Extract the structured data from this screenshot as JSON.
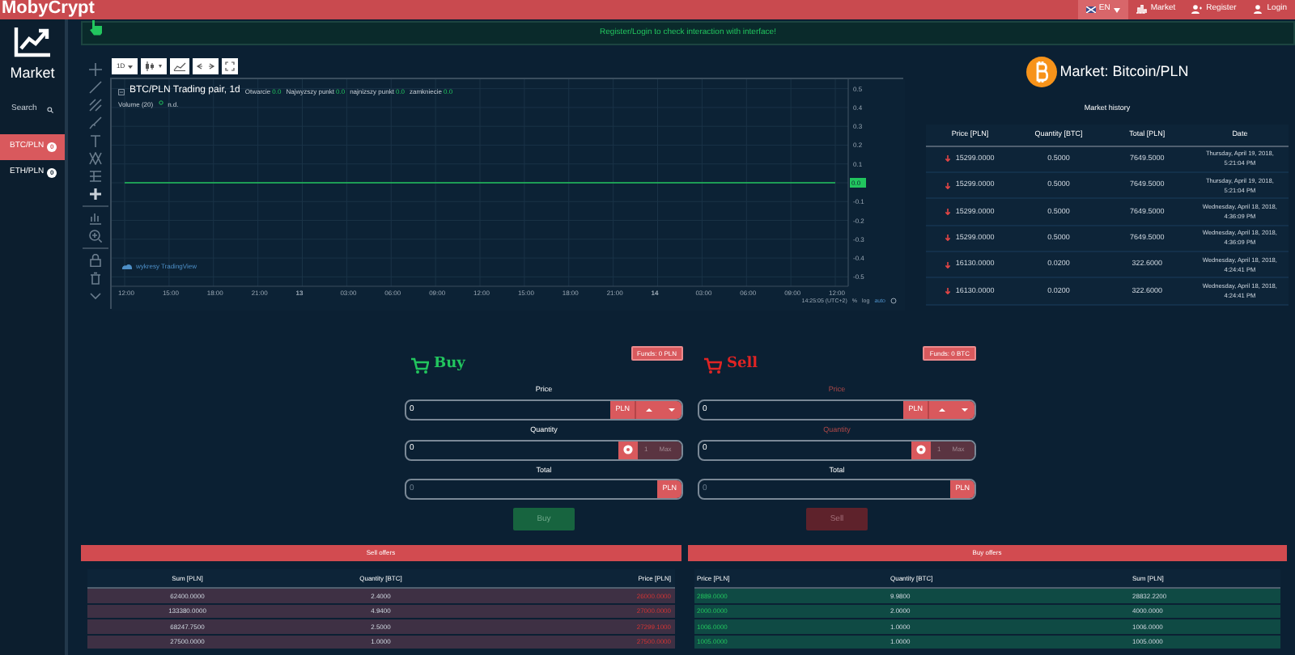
{
  "header": {
    "logo": "MobyCrypt",
    "language": {
      "label": "EN"
    },
    "nav": [
      {
        "label": "Market",
        "kind": "market"
      },
      {
        "label": "Register",
        "kind": "register"
      },
      {
        "label": "Login",
        "kind": "login"
      }
    ]
  },
  "sidebar": {
    "title": "Market",
    "search": {
      "placeholder": "Search"
    },
    "pairs": [
      {
        "label": "BTC/PLN",
        "count": "0",
        "selected": true
      },
      {
        "label": "ETH/PLN",
        "count": "0",
        "selected": false
      }
    ]
  },
  "banner": "Register/Login to check interaction with interface!",
  "chart_toolbar": {
    "interval": "1D"
  },
  "chart": {
    "title": "BTC/PLN Trading pair, 1d",
    "legend": [
      {
        "label": "Otwarcie",
        "value": "0.0"
      },
      {
        "label": "Najwyzszy punkt",
        "value": "0.0"
      },
      {
        "label": "najnizszy punkt",
        "value": "0.0"
      },
      {
        "label": "zamkniecie",
        "value": "0.0"
      }
    ],
    "volume": {
      "label": "Volume (20)",
      "value": "n.d."
    },
    "attribution": "wykresy TradingView",
    "time": "14:25:05 (UTC+2)",
    "options": [
      "%",
      "log",
      "auto"
    ],
    "chart_data": {
      "type": "line",
      "x": [
        "12:00",
        "15:00",
        "18:00",
        "21:00",
        "13",
        "03:00",
        "06:00",
        "09:00",
        "12:00",
        "15:00",
        "18:00",
        "21:00",
        "14",
        "03:00",
        "06:00",
        "09:00",
        "12:00"
      ],
      "series": [
        {
          "color": "#22c55e",
          "values": [
            0,
            0,
            0,
            0,
            0,
            0,
            0,
            0,
            0,
            0,
            0,
            0,
            0,
            0,
            0,
            0,
            0
          ]
        }
      ],
      "grid": true,
      "ylim": [
        -0.55,
        0.55
      ],
      "yticks": [
        {
          "value": 0.5,
          "label": "0.5"
        },
        {
          "value": 0.4,
          "label": "0.4"
        },
        {
          "value": 0.3,
          "label": "0.3"
        },
        {
          "value": 0.2,
          "label": "0.2"
        },
        {
          "value": 0.1,
          "label": "0.1"
        },
        {
          "value": 0,
          "label": "0.0"
        },
        {
          "value": -0.1,
          "label": "-0.1"
        },
        {
          "value": -0.2,
          "label": "-0.2"
        },
        {
          "value": -0.3,
          "label": "-0.3"
        },
        {
          "value": -0.4,
          "label": "-0.4"
        },
        {
          "value": -0.5,
          "label": "-0.5"
        }
      ]
    }
  },
  "market": {
    "title": "Market: Bitcoin/PLN",
    "history_title": "Market history",
    "columns": [
      "Price [PLN]",
      "Quantity [BTC]",
      "Total [PLN]",
      "Date"
    ],
    "rows": [
      {
        "price": "15299.0000",
        "quantity": "0.5000",
        "total": "7649.5000",
        "date": "Thursday, April 19, 2018, 5:21:04 PM"
      },
      {
        "price": "15299.0000",
        "quantity": "0.5000",
        "total": "7649.5000",
        "date": "Thursday, April 19, 2018, 5:21:04 PM"
      },
      {
        "price": "15299.0000",
        "quantity": "0.5000",
        "total": "7649.5000",
        "date": "Wednesday, April 18, 2018, 4:36:09 PM"
      },
      {
        "price": "15299.0000",
        "quantity": "0.5000",
        "total": "7649.5000",
        "date": "Wednesday, April 18, 2018, 4:36:09 PM"
      },
      {
        "price": "16130.0000",
        "quantity": "0.0200",
        "total": "322.6000",
        "date": "Wednesday, April 18, 2018, 4:24:41 PM"
      },
      {
        "price": "16130.0000",
        "quantity": "0.0200",
        "total": "322.6000",
        "date": "Wednesday, April 18, 2018, 4:24:41 PM"
      }
    ]
  },
  "orders": [
    {
      "kind": "buy",
      "title": "Buy",
      "funds": "Funds: 0 PLN",
      "price_label": "Price",
      "price": "0",
      "price_currency": "PLN",
      "quantity_label": "Quantity",
      "quantity": "0",
      "step": "1",
      "max": "Max",
      "total_label": "Total",
      "total_placeholder": "0",
      "total_currency": "PLN",
      "button": "Buy"
    },
    {
      "kind": "sell",
      "title": "Sell",
      "funds": "Funds: 0 BTC",
      "price_label": "Price",
      "price": "0",
      "price_currency": "PLN",
      "quantity_label": "Quantity",
      "quantity": "0",
      "step": "1",
      "max": "Max",
      "total_label": "Total",
      "total_placeholder": "0",
      "total_currency": "PLN",
      "button": "Sell"
    }
  ],
  "sell_offers": {
    "title": "Sell offers",
    "columns": [
      "Sum [PLN]",
      "Quantity [BTC]",
      "Price [PLN]"
    ],
    "rows": [
      [
        "62400.0000",
        "2.4000",
        "26000.0000"
      ],
      [
        "133380.0000",
        "4.9400",
        "27000.0000"
      ],
      [
        "68247.7500",
        "2.5000",
        "27299.1000"
      ],
      [
        "27500.0000",
        "1.0000",
        "27500.0000"
      ]
    ]
  },
  "buy_offers": {
    "title": "Buy offers",
    "columns": [
      "Price [PLN]",
      "Quantity [BTC]",
      "Sum [PLN]"
    ],
    "rows": [
      [
        "2889.0000",
        "9.9800",
        "28832.2200"
      ],
      [
        "2000.0000",
        "2.0000",
        "4000.0000"
      ],
      [
        "1006.0000",
        "1.0000",
        "1006.0000"
      ],
      [
        "1005.0000",
        "1.0000",
        "1005.0000"
      ]
    ]
  }
}
